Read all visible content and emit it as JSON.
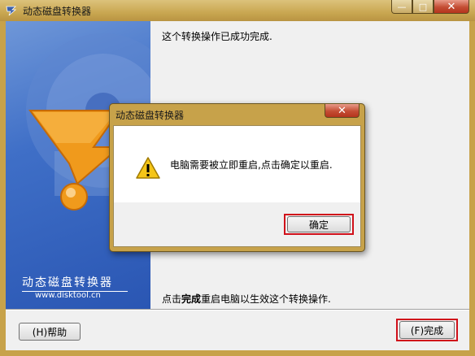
{
  "window": {
    "title": "动态磁盘转换器",
    "controls": {
      "minimize": "—",
      "maximize": "□",
      "close": "✕"
    }
  },
  "banner": {
    "title": "动态磁盘转换器",
    "url": "www.disktool.cn"
  },
  "content": {
    "top_message": "这个转换操作已成功完成.",
    "bottom_prefix": "点击",
    "bottom_bold": "完成",
    "bottom_suffix": "重启电脑以生效这个转换操作."
  },
  "buttons": {
    "help": "(H)帮助",
    "finish": "(F)完成"
  },
  "dialog": {
    "title": "动态磁盘转换器",
    "close": "✕",
    "message": "电脑需要被立即重启,点击确定以重启.",
    "ok": "确定"
  },
  "colors": {
    "title_bar": "#c7a24a",
    "banner_blue": "#3f6fc7",
    "highlight_red": "#d0101a",
    "logo_orange": "#f09a1c"
  }
}
